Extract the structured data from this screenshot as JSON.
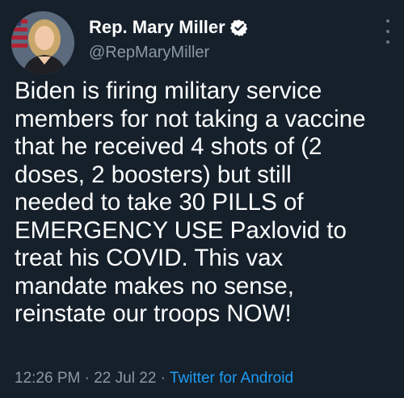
{
  "author": {
    "display_name": "Rep. Mary Miller",
    "handle": "@RepMaryMiller",
    "verified_icon": "verified-badge-icon",
    "avatar": "profile-photo"
  },
  "tweet": {
    "text": "Biden is firing military service\nmembers for not taking a vaccine\nthat he received 4 shots of (2\ndoses, 2 boosters) but still\nneeded to take 30 PILLS of\nEMERGENCY USE Paxlovid to\ntreat his COVID. This vax\nmandate makes no sense,\nreinstate our troops NOW!"
  },
  "meta": {
    "time": "12:26 PM",
    "separator": " · ",
    "date": "22 Jul 22",
    "source": "Twitter for Android"
  },
  "menu": {
    "icon": "more-vertical-icon"
  },
  "colors": {
    "background": "#15202b",
    "text": "#ffffff",
    "secondary": "#8b98a5",
    "accent": "#1d9bf0"
  }
}
